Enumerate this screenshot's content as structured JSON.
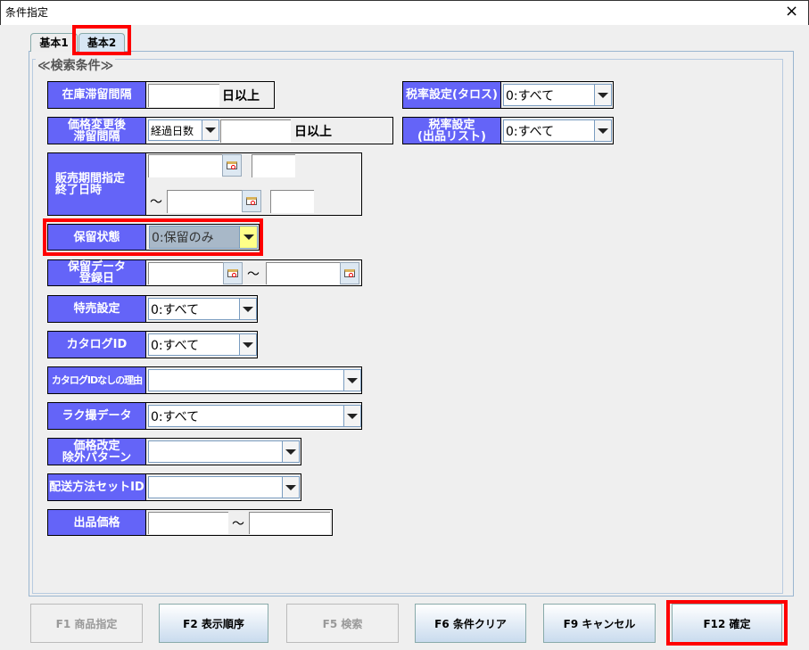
{
  "window": {
    "title": "条件指定",
    "close": "×"
  },
  "tabs": [
    {
      "label": "基本1"
    },
    {
      "label": "基本2",
      "selected": true
    }
  ],
  "group_title": "≪検索条件≫",
  "fields": {
    "stock_interval": {
      "label": "在庫滞留間隔",
      "value": "",
      "unit": "日以上"
    },
    "price_change": {
      "label1": "価格変更後",
      "label2": "滞留間隔",
      "combo": "経過日数",
      "value": "",
      "unit": "日以上"
    },
    "sales_period": {
      "label1": "販売期間指定",
      "label2": "終了日時",
      "tilde": "～"
    },
    "hold_status": {
      "label": "保留状態",
      "value": "0:保留のみ"
    },
    "hold_date": {
      "label1": "保留データ",
      "label2": "登録日",
      "tilde": "～"
    },
    "special_sale": {
      "label": "特売設定",
      "value": "0:すべて"
    },
    "catalog_id": {
      "label": "カタログID",
      "value": "0:すべて"
    },
    "no_catalog_reason": {
      "label": "カタログIDなしの理由",
      "value": ""
    },
    "raku_data": {
      "label": "ラク撮データ",
      "value": "0:すべて"
    },
    "price_revision": {
      "label1": "価格改定",
      "label2": "除外パターン",
      "value": ""
    },
    "shipping_set": {
      "label": "配送方法セットID",
      "value": ""
    },
    "listing_price": {
      "label": "出品価格",
      "tilde": "～"
    },
    "tax_taros": {
      "label": "税率設定(タロス)",
      "value": "0:すべて"
    },
    "tax_listing": {
      "label1": "税率設定",
      "label2": "(出品リスト)",
      "value": "0:すべて"
    }
  },
  "buttons": [
    {
      "label": "F1 商品指定",
      "enabled": false
    },
    {
      "label": "F2 表示順序",
      "enabled": true
    },
    {
      "label": "F5 検索",
      "enabled": false
    },
    {
      "label": "F6 条件クリア",
      "enabled": true
    },
    {
      "label": "F9 キャンセル",
      "enabled": true
    },
    {
      "label": "F12 確定",
      "enabled": true
    }
  ]
}
